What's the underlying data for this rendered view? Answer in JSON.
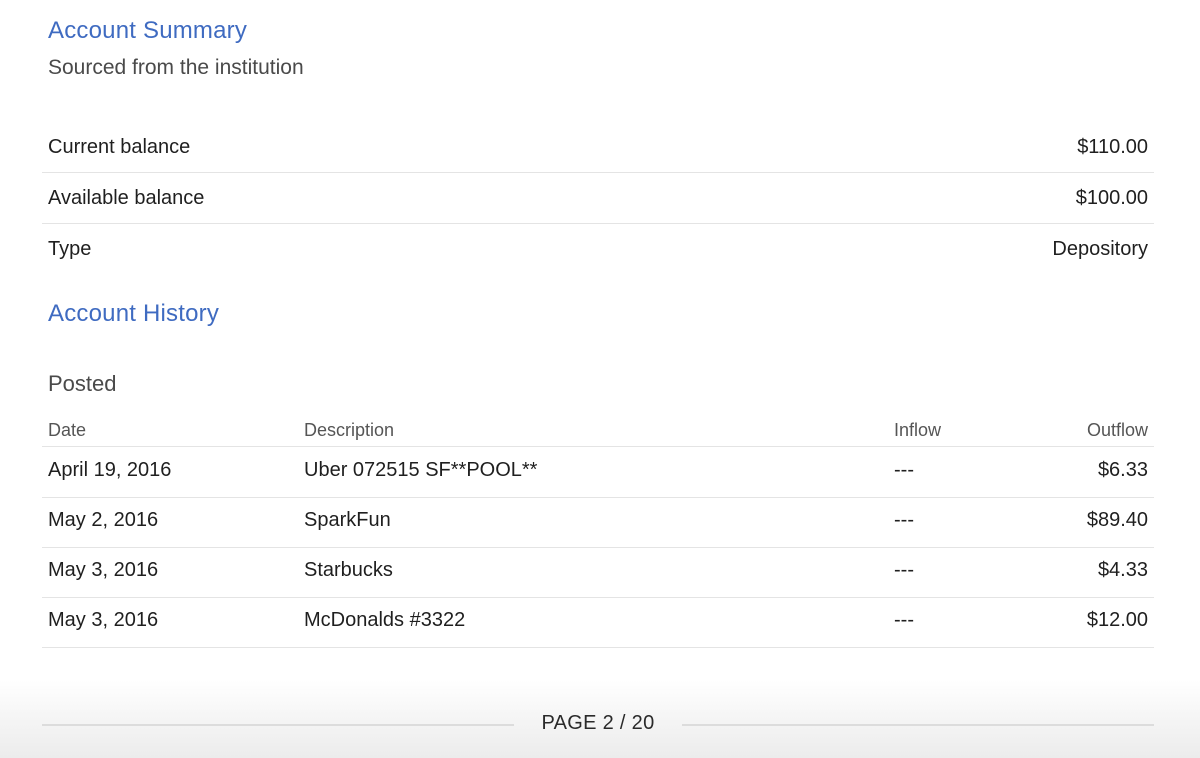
{
  "summary": {
    "title": "Account Summary",
    "subtitle": "Sourced from the institution",
    "rows": [
      {
        "label": "Current balance",
        "value": "$110.00"
      },
      {
        "label": "Available balance",
        "value": "$100.00"
      },
      {
        "label": "Type",
        "value": "Depository"
      }
    ]
  },
  "history": {
    "title": "Account History",
    "subsection": "Posted",
    "columns": {
      "date": "Date",
      "description": "Description",
      "inflow": "Inflow",
      "outflow": "Outflow"
    },
    "transactions": [
      {
        "date": "April 19, 2016",
        "description": "Uber 072515 SF**POOL**",
        "inflow": "---",
        "outflow": "$6.33"
      },
      {
        "date": "May 2, 2016",
        "description": "SparkFun",
        "inflow": "---",
        "outflow": "$89.40"
      },
      {
        "date": "May 3, 2016",
        "description": "Starbucks",
        "inflow": "---",
        "outflow": "$4.33"
      },
      {
        "date": "May 3, 2016",
        "description": "McDonalds #3322",
        "inflow": "---",
        "outflow": "$12.00"
      }
    ]
  },
  "footer": {
    "page_label": "PAGE 2 / 20"
  },
  "colors": {
    "heading": "#3f6bc1",
    "divider": "#e4e4e4"
  }
}
